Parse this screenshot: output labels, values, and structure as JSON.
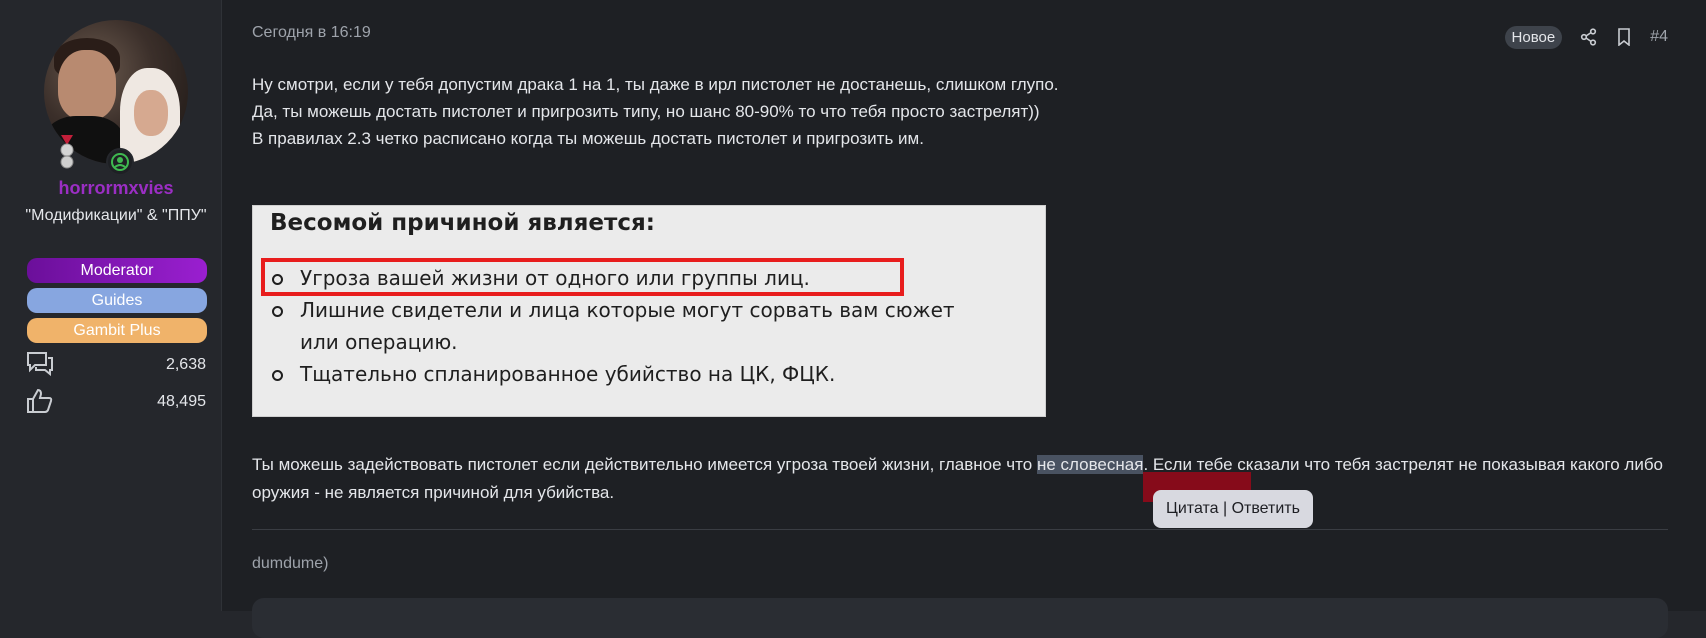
{
  "user": {
    "username": "horrormxvies",
    "title": "\"Модификации\" & \"ППУ\"",
    "banners": [
      {
        "label": "Moderator",
        "color": "#9a1fd0"
      },
      {
        "label": "Guides",
        "color": "#87a6e0"
      },
      {
        "label": "Gambit Plus",
        "color": "#f0b36a"
      }
    ],
    "stats": {
      "messages": "2,638",
      "reactions": "48,495"
    }
  },
  "post": {
    "time": "Сегодня в 16:19",
    "new_badge": "Новое",
    "number": "#4",
    "paragraph1": [
      "Ну смотри, если у тебя допустим драка 1 на 1, ты даже в ирл пистолет не достанешь, слишком глупо.",
      "Да, ты можешь достать пистолет и пригрозить типу, но шанс 80-90% то что тебя просто застрелят))",
      "В правилах 2.3 четко расписано когда ты можешь достать пистолет и пригрозить им."
    ],
    "image": {
      "heading": "Весомой причиной является:",
      "items": [
        "Угроза вашей жизни от одного или группы лиц.",
        "Лишние свидетели и лица которые могут сорвать вам сюжет или операцию.",
        "Тщательно спланированное убийство на ЦК, ФЦК."
      ]
    },
    "paragraph2_before": "Ты можешь задействовать пистолет если действительно имеется угроза твоей жизни, главное что ",
    "paragraph2_highlight": "не словесная",
    "paragraph2_after": ". Если тебе сказали что тебя застрелят не показывая какого либо оружия - не является причиной для убийства.",
    "quote_popup": "Цитата | Ответить",
    "signature": "dumdume)"
  },
  "colors": {
    "username": "#9b2ec4",
    "highlight": "#495261",
    "red_box": "#e81d1d"
  }
}
